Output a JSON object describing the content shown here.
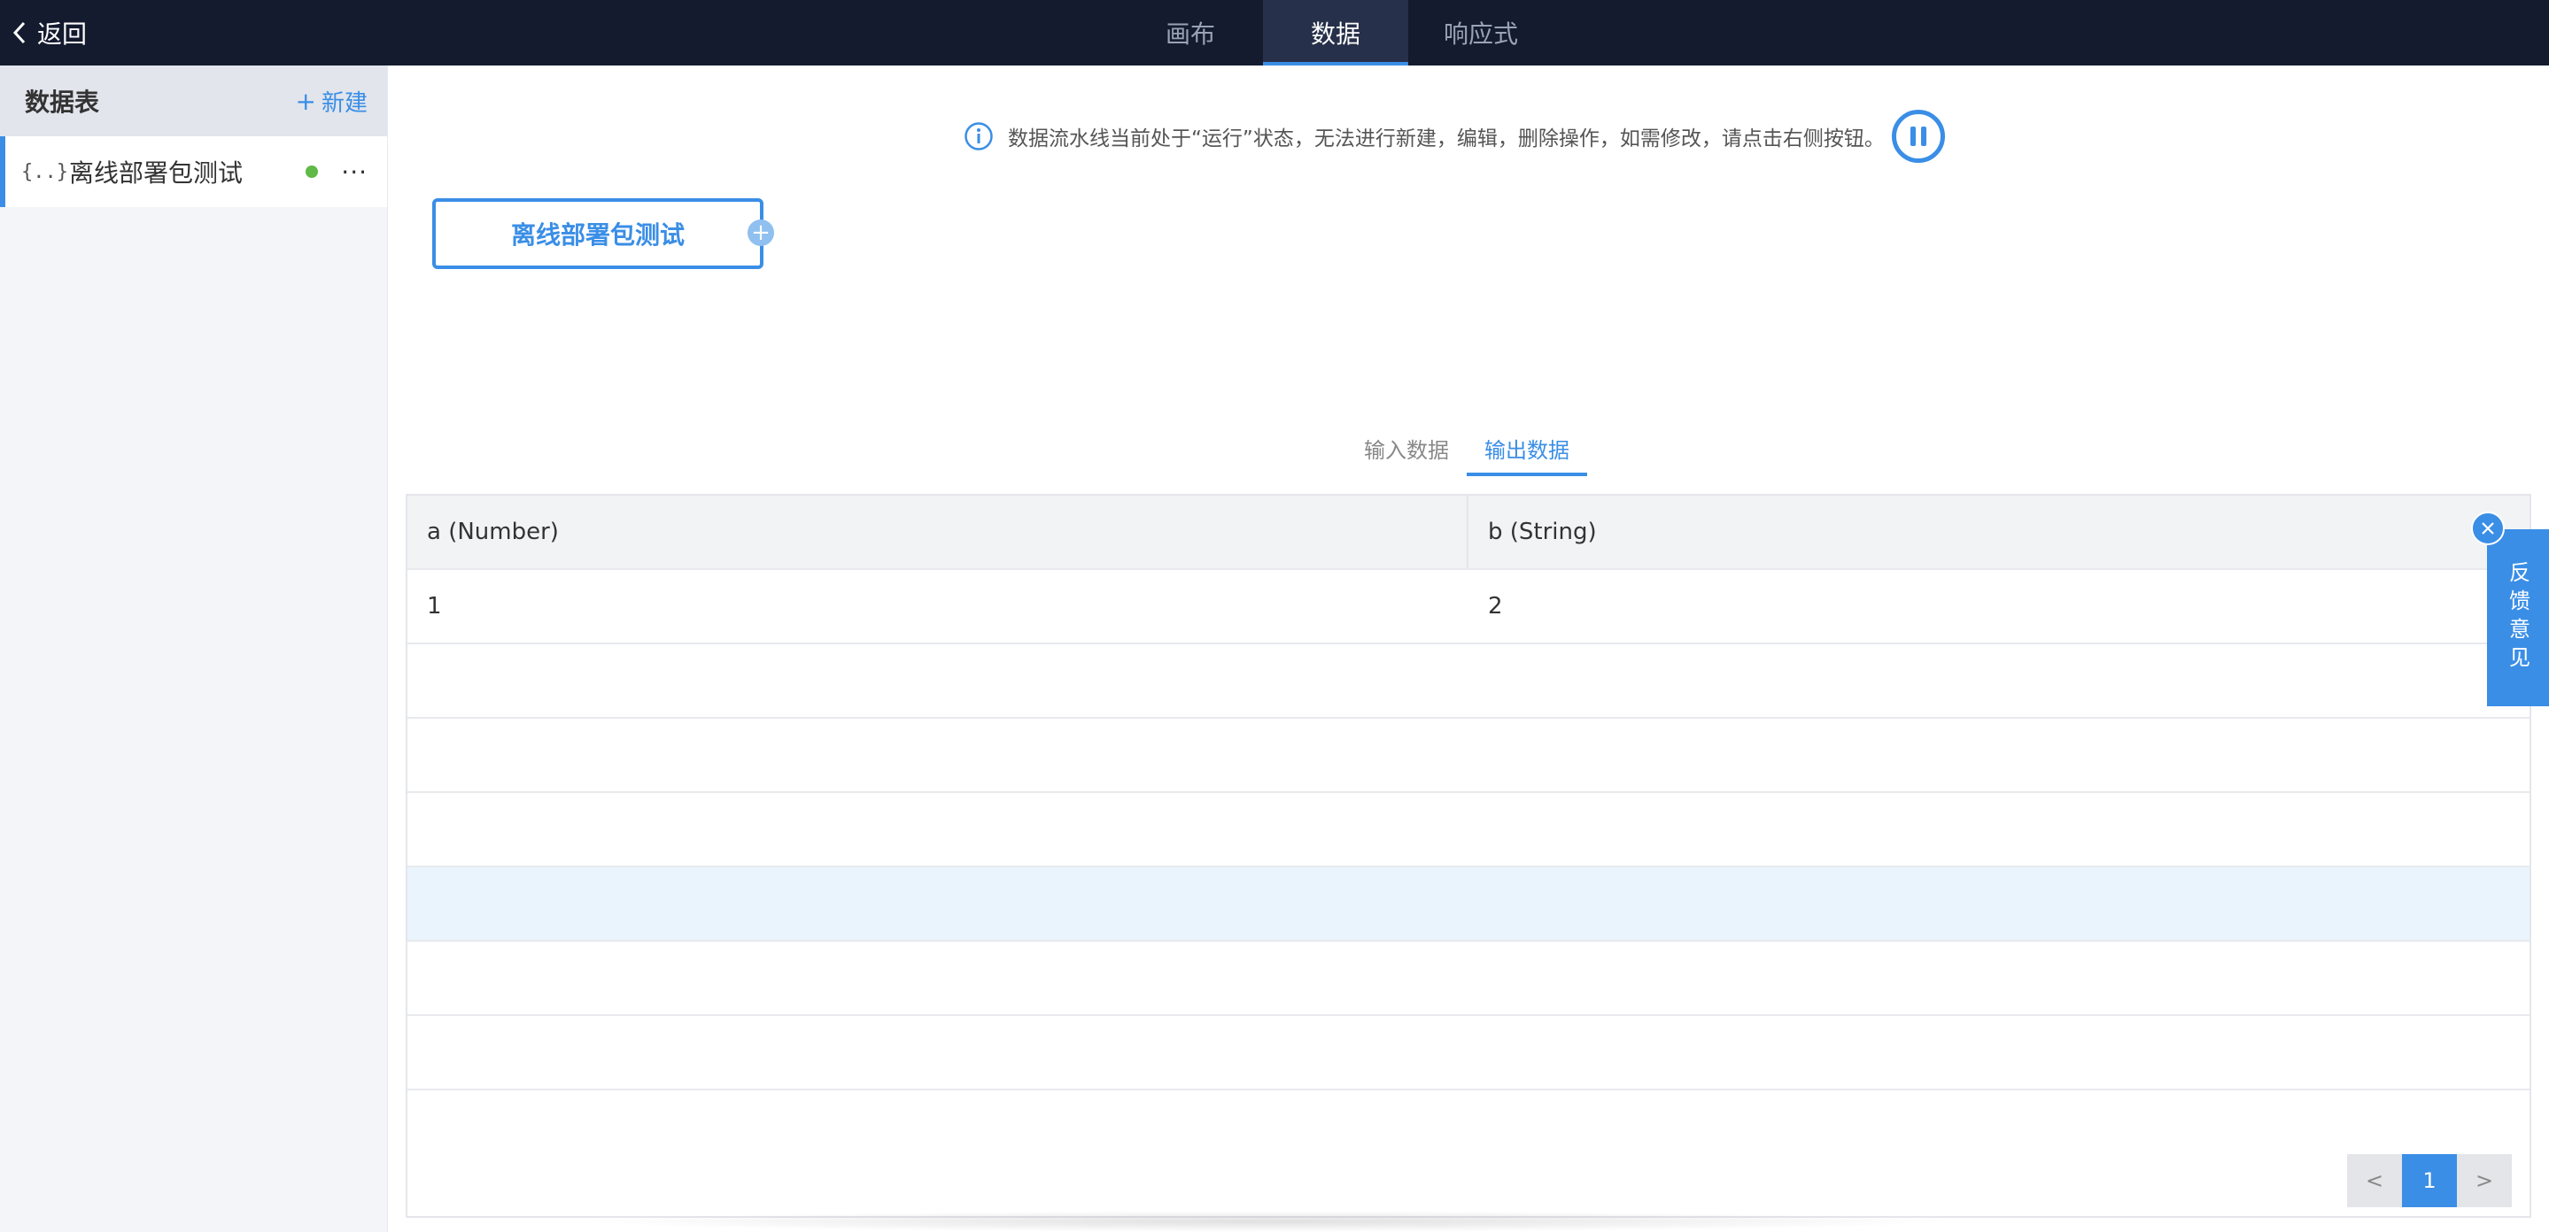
{
  "topbar": {
    "back_label": "返回",
    "tabs": [
      {
        "label": "画布"
      },
      {
        "label": "数据"
      },
      {
        "label": "响应式"
      }
    ],
    "active_tab": "数据"
  },
  "sidebar": {
    "title": "数据表",
    "new_label": "新建",
    "new_icon": "+",
    "items": [
      {
        "icon": "{..}",
        "label": "离线部署包测试",
        "status_color": "#5fba46",
        "more": "···"
      }
    ]
  },
  "notice": {
    "text": "数据流水线当前处于“运行”状态，无法进行新建，编辑，删除操作，如需修改，请点击右侧按钮。"
  },
  "node": {
    "label": "离线部署包测试",
    "plus": "+"
  },
  "data_tabs": [
    {
      "label": "输入数据"
    },
    {
      "label": "输出数据"
    }
  ],
  "active_data_tab": "输出数据",
  "table": {
    "headers": [
      "a (Number)",
      "b (String)"
    ],
    "rows": [
      [
        "1",
        "2"
      ],
      [
        "",
        ""
      ],
      [
        "",
        ""
      ],
      [
        "",
        ""
      ],
      [
        "",
        ""
      ],
      [
        "",
        ""
      ],
      [
        "",
        ""
      ]
    ]
  },
  "pagination": {
    "prev": "<",
    "current": "1",
    "next": ">"
  },
  "feedback": {
    "label": "反馈意见"
  },
  "colors": {
    "accent": "#3a8ee6",
    "topbar_bg": "#141b2f",
    "status_running": "#5fba46"
  }
}
